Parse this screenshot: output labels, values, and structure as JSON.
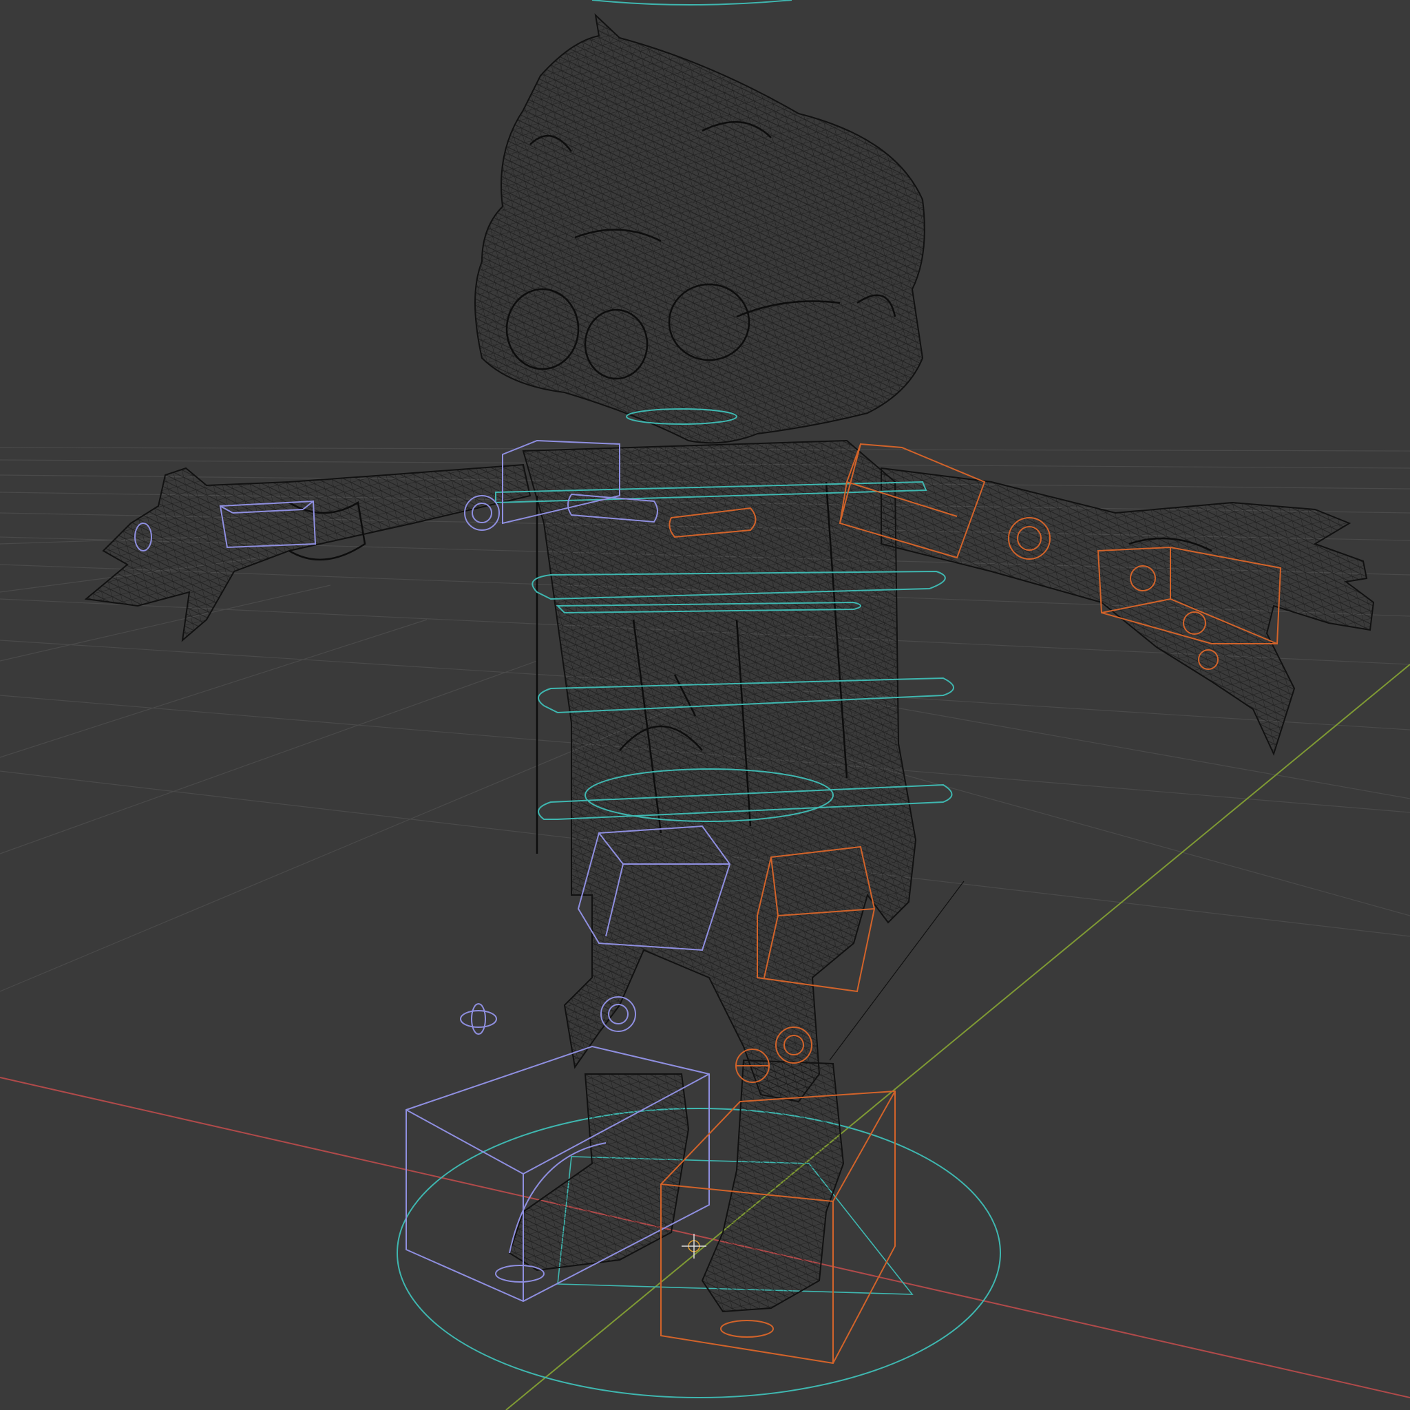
{
  "viewport": {
    "mode": "wireframe",
    "background_color": "#3a3a3a",
    "grid_color": "#4a4a4a",
    "mesh_wire_color": "#141414",
    "axis_x_color": "#b04a4a",
    "axis_y_color": "#7f9a34",
    "controls_left_color": "#8f8fe0",
    "controls_right_color": "#d2632a",
    "controls_center_color": "#3fb7b0"
  },
  "scene": {
    "character": "cartoon-boy-rig",
    "pose": "t-pose"
  }
}
